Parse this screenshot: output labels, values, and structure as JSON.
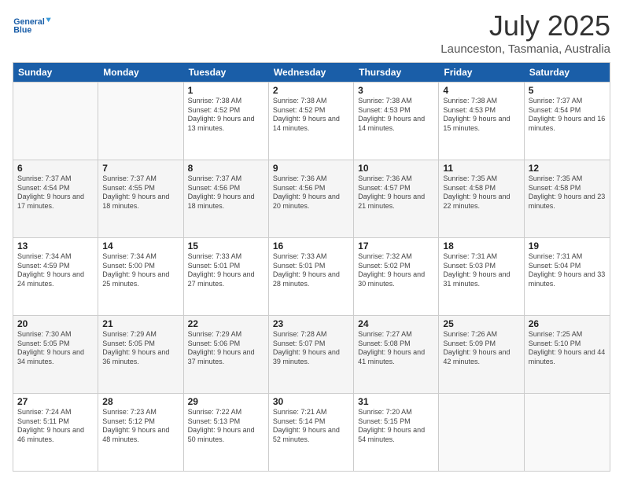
{
  "logo": {
    "line1": "General",
    "line2": "Blue"
  },
  "title": "July 2025",
  "subtitle": "Launceston, Tasmania, Australia",
  "days": [
    "Sunday",
    "Monday",
    "Tuesday",
    "Wednesday",
    "Thursday",
    "Friday",
    "Saturday"
  ],
  "weeks": [
    [
      {
        "day": "",
        "sunrise": "",
        "sunset": "",
        "daylight": ""
      },
      {
        "day": "",
        "sunrise": "",
        "sunset": "",
        "daylight": ""
      },
      {
        "day": "1",
        "sunrise": "Sunrise: 7:38 AM",
        "sunset": "Sunset: 4:52 PM",
        "daylight": "Daylight: 9 hours and 13 minutes."
      },
      {
        "day": "2",
        "sunrise": "Sunrise: 7:38 AM",
        "sunset": "Sunset: 4:52 PM",
        "daylight": "Daylight: 9 hours and 14 minutes."
      },
      {
        "day": "3",
        "sunrise": "Sunrise: 7:38 AM",
        "sunset": "Sunset: 4:53 PM",
        "daylight": "Daylight: 9 hours and 14 minutes."
      },
      {
        "day": "4",
        "sunrise": "Sunrise: 7:38 AM",
        "sunset": "Sunset: 4:53 PM",
        "daylight": "Daylight: 9 hours and 15 minutes."
      },
      {
        "day": "5",
        "sunrise": "Sunrise: 7:37 AM",
        "sunset": "Sunset: 4:54 PM",
        "daylight": "Daylight: 9 hours and 16 minutes."
      }
    ],
    [
      {
        "day": "6",
        "sunrise": "Sunrise: 7:37 AM",
        "sunset": "Sunset: 4:54 PM",
        "daylight": "Daylight: 9 hours and 17 minutes."
      },
      {
        "day": "7",
        "sunrise": "Sunrise: 7:37 AM",
        "sunset": "Sunset: 4:55 PM",
        "daylight": "Daylight: 9 hours and 18 minutes."
      },
      {
        "day": "8",
        "sunrise": "Sunrise: 7:37 AM",
        "sunset": "Sunset: 4:56 PM",
        "daylight": "Daylight: 9 hours and 18 minutes."
      },
      {
        "day": "9",
        "sunrise": "Sunrise: 7:36 AM",
        "sunset": "Sunset: 4:56 PM",
        "daylight": "Daylight: 9 hours and 20 minutes."
      },
      {
        "day": "10",
        "sunrise": "Sunrise: 7:36 AM",
        "sunset": "Sunset: 4:57 PM",
        "daylight": "Daylight: 9 hours and 21 minutes."
      },
      {
        "day": "11",
        "sunrise": "Sunrise: 7:35 AM",
        "sunset": "Sunset: 4:58 PM",
        "daylight": "Daylight: 9 hours and 22 minutes."
      },
      {
        "day": "12",
        "sunrise": "Sunrise: 7:35 AM",
        "sunset": "Sunset: 4:58 PM",
        "daylight": "Daylight: 9 hours and 23 minutes."
      }
    ],
    [
      {
        "day": "13",
        "sunrise": "Sunrise: 7:34 AM",
        "sunset": "Sunset: 4:59 PM",
        "daylight": "Daylight: 9 hours and 24 minutes."
      },
      {
        "day": "14",
        "sunrise": "Sunrise: 7:34 AM",
        "sunset": "Sunset: 5:00 PM",
        "daylight": "Daylight: 9 hours and 25 minutes."
      },
      {
        "day": "15",
        "sunrise": "Sunrise: 7:33 AM",
        "sunset": "Sunset: 5:01 PM",
        "daylight": "Daylight: 9 hours and 27 minutes."
      },
      {
        "day": "16",
        "sunrise": "Sunrise: 7:33 AM",
        "sunset": "Sunset: 5:01 PM",
        "daylight": "Daylight: 9 hours and 28 minutes."
      },
      {
        "day": "17",
        "sunrise": "Sunrise: 7:32 AM",
        "sunset": "Sunset: 5:02 PM",
        "daylight": "Daylight: 9 hours and 30 minutes."
      },
      {
        "day": "18",
        "sunrise": "Sunrise: 7:31 AM",
        "sunset": "Sunset: 5:03 PM",
        "daylight": "Daylight: 9 hours and 31 minutes."
      },
      {
        "day": "19",
        "sunrise": "Sunrise: 7:31 AM",
        "sunset": "Sunset: 5:04 PM",
        "daylight": "Daylight: 9 hours and 33 minutes."
      }
    ],
    [
      {
        "day": "20",
        "sunrise": "Sunrise: 7:30 AM",
        "sunset": "Sunset: 5:05 PM",
        "daylight": "Daylight: 9 hours and 34 minutes."
      },
      {
        "day": "21",
        "sunrise": "Sunrise: 7:29 AM",
        "sunset": "Sunset: 5:05 PM",
        "daylight": "Daylight: 9 hours and 36 minutes."
      },
      {
        "day": "22",
        "sunrise": "Sunrise: 7:29 AM",
        "sunset": "Sunset: 5:06 PM",
        "daylight": "Daylight: 9 hours and 37 minutes."
      },
      {
        "day": "23",
        "sunrise": "Sunrise: 7:28 AM",
        "sunset": "Sunset: 5:07 PM",
        "daylight": "Daylight: 9 hours and 39 minutes."
      },
      {
        "day": "24",
        "sunrise": "Sunrise: 7:27 AM",
        "sunset": "Sunset: 5:08 PM",
        "daylight": "Daylight: 9 hours and 41 minutes."
      },
      {
        "day": "25",
        "sunrise": "Sunrise: 7:26 AM",
        "sunset": "Sunset: 5:09 PM",
        "daylight": "Daylight: 9 hours and 42 minutes."
      },
      {
        "day": "26",
        "sunrise": "Sunrise: 7:25 AM",
        "sunset": "Sunset: 5:10 PM",
        "daylight": "Daylight: 9 hours and 44 minutes."
      }
    ],
    [
      {
        "day": "27",
        "sunrise": "Sunrise: 7:24 AM",
        "sunset": "Sunset: 5:11 PM",
        "daylight": "Daylight: 9 hours and 46 minutes."
      },
      {
        "day": "28",
        "sunrise": "Sunrise: 7:23 AM",
        "sunset": "Sunset: 5:12 PM",
        "daylight": "Daylight: 9 hours and 48 minutes."
      },
      {
        "day": "29",
        "sunrise": "Sunrise: 7:22 AM",
        "sunset": "Sunset: 5:13 PM",
        "daylight": "Daylight: 9 hours and 50 minutes."
      },
      {
        "day": "30",
        "sunrise": "Sunrise: 7:21 AM",
        "sunset": "Sunset: 5:14 PM",
        "daylight": "Daylight: 9 hours and 52 minutes."
      },
      {
        "day": "31",
        "sunrise": "Sunrise: 7:20 AM",
        "sunset": "Sunset: 5:15 PM",
        "daylight": "Daylight: 9 hours and 54 minutes."
      },
      {
        "day": "",
        "sunrise": "",
        "sunset": "",
        "daylight": ""
      },
      {
        "day": "",
        "sunrise": "",
        "sunset": "",
        "daylight": ""
      }
    ]
  ]
}
